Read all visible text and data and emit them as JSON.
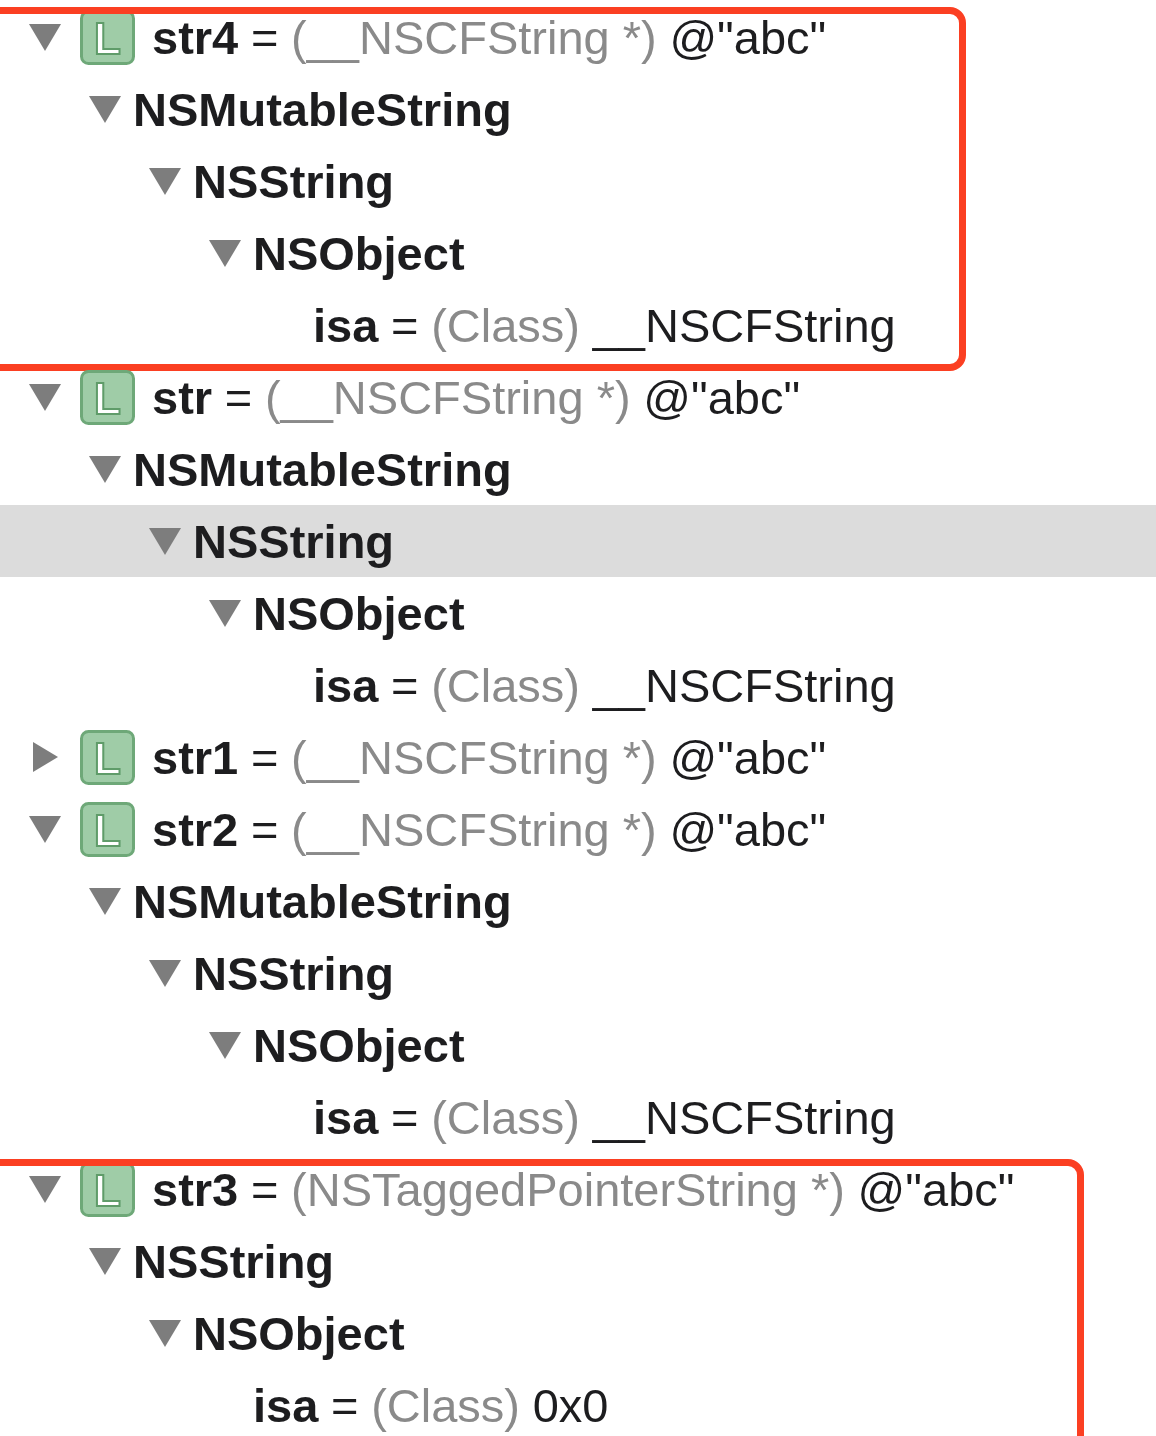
{
  "variables": [
    {
      "kind": "variable",
      "badge": "L",
      "name": "str4",
      "separator": "=",
      "type": "(__NSCFString *)",
      "value": "@\"abc\"",
      "expanded": true,
      "selected": false,
      "boxed": true,
      "children": [
        {
          "kind": "class",
          "name": "NSMutableString",
          "expanded": true,
          "selected": false,
          "children": [
            {
              "kind": "class",
              "name": "NSString",
              "expanded": true,
              "selected": false,
              "children": [
                {
                  "kind": "class",
                  "name": "NSObject",
                  "expanded": true,
                  "selected": false,
                  "children": [
                    {
                      "kind": "member",
                      "name": "isa",
                      "separator": "=",
                      "type": "(Class)",
                      "value": "__NSCFString",
                      "selected": false
                    }
                  ]
                }
              ]
            }
          ]
        }
      ]
    },
    {
      "kind": "variable",
      "badge": "L",
      "name": "str",
      "separator": "=",
      "type": "(__NSCFString *)",
      "value": "@\"abc\"",
      "expanded": true,
      "selected": false,
      "boxed": false,
      "children": [
        {
          "kind": "class",
          "name": "NSMutableString",
          "expanded": true,
          "selected": false,
          "children": [
            {
              "kind": "class",
              "name": "NSString",
              "expanded": true,
              "selected": true,
              "children": [
                {
                  "kind": "class",
                  "name": "NSObject",
                  "expanded": true,
                  "selected": false,
                  "children": [
                    {
                      "kind": "member",
                      "name": "isa",
                      "separator": "=",
                      "type": "(Class)",
                      "value": "__NSCFString",
                      "selected": false
                    }
                  ]
                }
              ]
            }
          ]
        }
      ]
    },
    {
      "kind": "variable",
      "badge": "L",
      "name": "str1",
      "separator": "=",
      "type": "(__NSCFString *)",
      "value": "@\"abc\"",
      "expanded": false,
      "selected": false,
      "boxed": false
    },
    {
      "kind": "variable",
      "badge": "L",
      "name": "str2",
      "separator": "=",
      "type": "(__NSCFString *)",
      "value": "@\"abc\"",
      "expanded": true,
      "selected": false,
      "boxed": false,
      "children": [
        {
          "kind": "class",
          "name": "NSMutableString",
          "expanded": true,
          "selected": false,
          "children": [
            {
              "kind": "class",
              "name": "NSString",
              "expanded": true,
              "selected": false,
              "children": [
                {
                  "kind": "class",
                  "name": "NSObject",
                  "expanded": true,
                  "selected": false,
                  "children": [
                    {
                      "kind": "member",
                      "name": "isa",
                      "separator": "=",
                      "type": "(Class)",
                      "value": "__NSCFString",
                      "selected": false
                    }
                  ]
                }
              ]
            }
          ]
        }
      ]
    },
    {
      "kind": "variable",
      "badge": "L",
      "name": "str3",
      "separator": "=",
      "type": "(NSTaggedPointerString *)",
      "value": "@\"abc\"",
      "expanded": true,
      "selected": false,
      "boxed": true,
      "children": [
        {
          "kind": "class",
          "name": "NSString",
          "expanded": true,
          "selected": false,
          "children": [
            {
              "kind": "class",
              "name": "NSObject",
              "expanded": true,
              "selected": false,
              "children": [
                {
                  "kind": "member",
                  "name": "isa",
                  "separator": "=",
                  "type": "(Class)",
                  "value": "0x0",
                  "selected": false
                }
              ]
            }
          ]
        }
      ]
    }
  ]
}
